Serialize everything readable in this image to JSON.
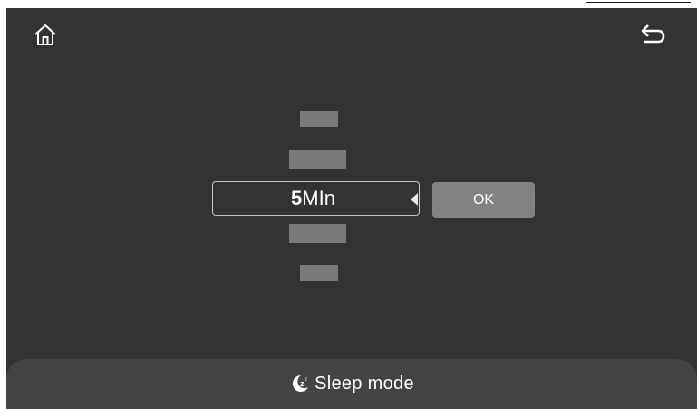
{
  "header": {
    "home_icon": "home-icon",
    "back_icon": "back-arrow-icon"
  },
  "picker": {
    "selected_number": "5",
    "selected_unit": "MIn",
    "pointer_icon": "triangle-left-icon"
  },
  "actions": {
    "ok_label": "OK"
  },
  "footer": {
    "icon": "sleep-moon-icon",
    "mode_label": "Sleep mode"
  },
  "colors": {
    "background": "#333333",
    "footer": "#444444",
    "button": "#828282",
    "wheel_item": "#7a7a7a",
    "text": "#ffffff"
  }
}
